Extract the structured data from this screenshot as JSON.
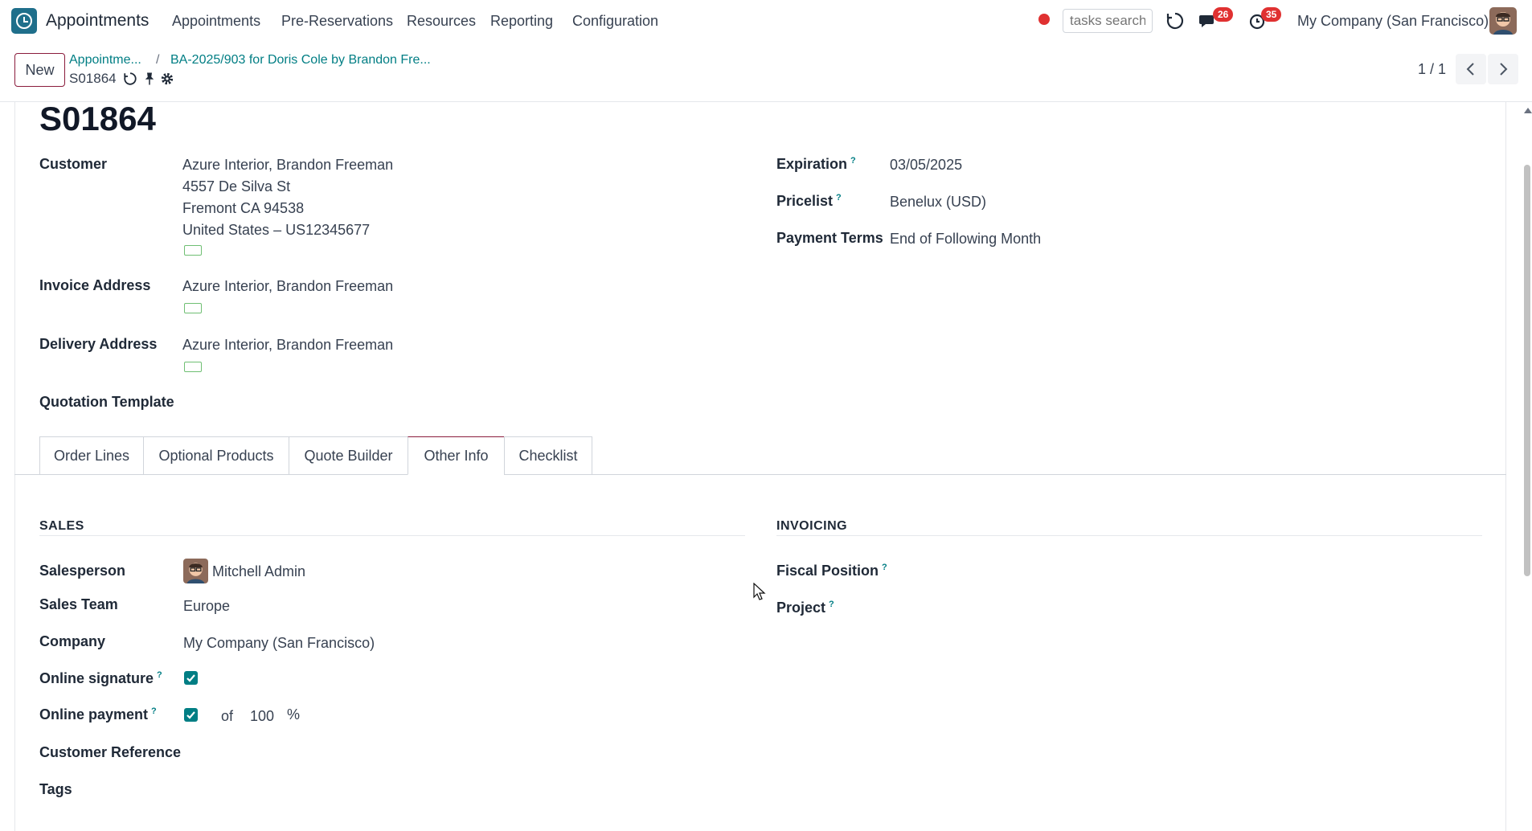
{
  "navbar": {
    "app_name": "Appointments",
    "menus": [
      "Appointments",
      "Pre-Reservations",
      "Resources",
      "Reporting",
      "Configuration"
    ],
    "search_placeholder": "tasks search",
    "messages_badge": "26",
    "activities_badge": "35",
    "company": "My Company (San Francisco)"
  },
  "control": {
    "new_label": "New",
    "breadcrumb_1": "Appointme...",
    "breadcrumb_2": "BA-2025/903 for Doris Cole by Brandon Fre...",
    "record_name": "S01864",
    "pager": "1 / 1"
  },
  "form": {
    "title": "S01864",
    "customer_label": "Customer",
    "customer_lines": [
      "Azure Interior, Brandon Freeman",
      "4557 De Silva St",
      "Fremont CA 94538",
      "United States – US12345677"
    ],
    "invoice_label": "Invoice Address",
    "invoice_value": "Azure Interior, Brandon Freeman",
    "delivery_label": "Delivery Address",
    "delivery_value": "Azure Interior, Brandon Freeman",
    "template_label": "Quotation Template",
    "expiration_label": "Expiration",
    "expiration_value": "03/05/2025",
    "pricelist_label": "Pricelist",
    "pricelist_value": "Benelux (USD)",
    "payment_terms_label": "Payment Terms",
    "payment_terms_value": "End of Following Month",
    "help_mark": "?"
  },
  "tabs": [
    "Order Lines",
    "Optional Products",
    "Quote Builder",
    "Other Info",
    "Checklist"
  ],
  "active_tab": "Other Info",
  "sales": {
    "title": "SALES",
    "salesperson_label": "Salesperson",
    "salesperson_value": "Mitchell Admin",
    "team_label": "Sales Team",
    "team_value": "Europe",
    "company_label": "Company",
    "company_value": "My Company (San Francisco)",
    "signature_label": "Online signature",
    "signature_checked": true,
    "payment_label": "Online payment",
    "payment_checked": true,
    "payment_of": "of",
    "payment_percent": "100",
    "percent_sign": "%",
    "reference_label": "Customer Reference",
    "tags_label": "Tags"
  },
  "invoicing": {
    "title": "INVOICING",
    "fiscal_label": "Fiscal Position",
    "project_label": "Project"
  },
  "colors": {
    "accent": "#017e84",
    "brand": "#8a1c3c",
    "badge": "#e03131"
  }
}
